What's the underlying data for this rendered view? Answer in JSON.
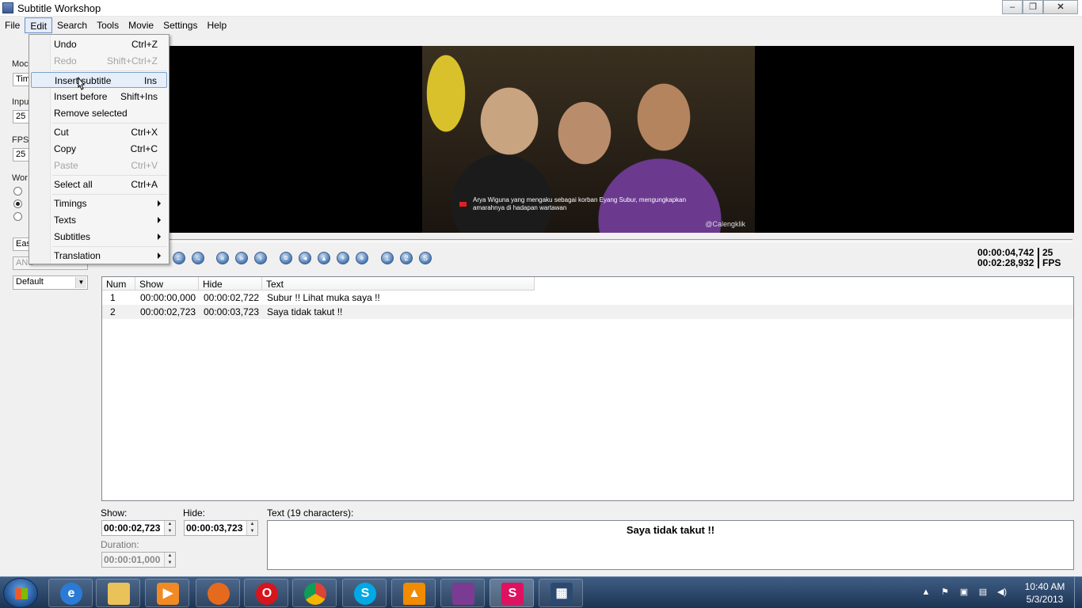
{
  "window": {
    "title": "Subtitle Workshop"
  },
  "menubar": [
    "File",
    "Edit",
    "Search",
    "Tools",
    "Movie",
    "Settings",
    "Help"
  ],
  "left_panel": {
    "mode_label": "Moc",
    "mode_value": "Tim",
    "input_label": "Inpu",
    "input_value": "25",
    "fps_label": "FPS",
    "fps_value": "25",
    "work_label": "Wor",
    "option1_value": "Eas",
    "option2_value": "ANS",
    "style_value": "Default"
  },
  "video": {
    "caption_line1": "Arya Wiguna yang mengaku sebagai korban Eyang Subur, mengungkapkan",
    "caption_line2": "amarahnya di hadapan wartawan",
    "watermark": "@Calengklik"
  },
  "player": {
    "current_time": "00:00:04,742",
    "total_time": "00:02:28,932",
    "fps_value": "25",
    "fps_label": "FPS"
  },
  "grid": {
    "columns": [
      "Num",
      "Show",
      "Hide",
      "Text"
    ],
    "rows": [
      [
        "1",
        "00:00:00,000",
        "00:00:02,722",
        "Subur !! Lihat muka saya !!"
      ],
      [
        "2",
        "00:00:02,723",
        "00:00:03,723",
        "Saya tidak takut !!"
      ]
    ]
  },
  "editor": {
    "show_label": "Show:",
    "show_value": "00:00:02,723",
    "hide_label": "Hide:",
    "hide_value": "00:00:03,723",
    "duration_label": "Duration:",
    "duration_value": "00:00:01,000",
    "text_label": "Text (19 characters):",
    "text_value": "Saya tidak takut !!"
  },
  "edit_menu": [
    {
      "label": "Undo",
      "shortcut": "Ctrl+Z"
    },
    {
      "label": "Redo",
      "shortcut": "Shift+Ctrl+Z"
    },
    {
      "label": "Insert subtitle",
      "shortcut": "Ins"
    },
    {
      "label": "Insert before",
      "shortcut": "Shift+Ins"
    },
    {
      "label": "Remove selected",
      "shortcut": ""
    },
    {
      "label": "Cut",
      "shortcut": "Ctrl+X"
    },
    {
      "label": "Copy",
      "shortcut": "Ctrl+C"
    },
    {
      "label": "Paste",
      "shortcut": "Ctrl+V"
    },
    {
      "label": "Select all",
      "shortcut": "Ctrl+A"
    },
    {
      "label": "Timings",
      "shortcut": ""
    },
    {
      "label": "Texts",
      "shortcut": ""
    },
    {
      "label": "Subtitles",
      "shortcut": ""
    },
    {
      "label": "Translation",
      "shortcut": ""
    }
  ],
  "taskbar": {
    "clock_time": "10:40 AM",
    "clock_date": "5/3/2013"
  },
  "colors": {
    "taskbar": "#1c3454",
    "menu_highlight": "#e5eef9",
    "video_bg": "#000000"
  }
}
